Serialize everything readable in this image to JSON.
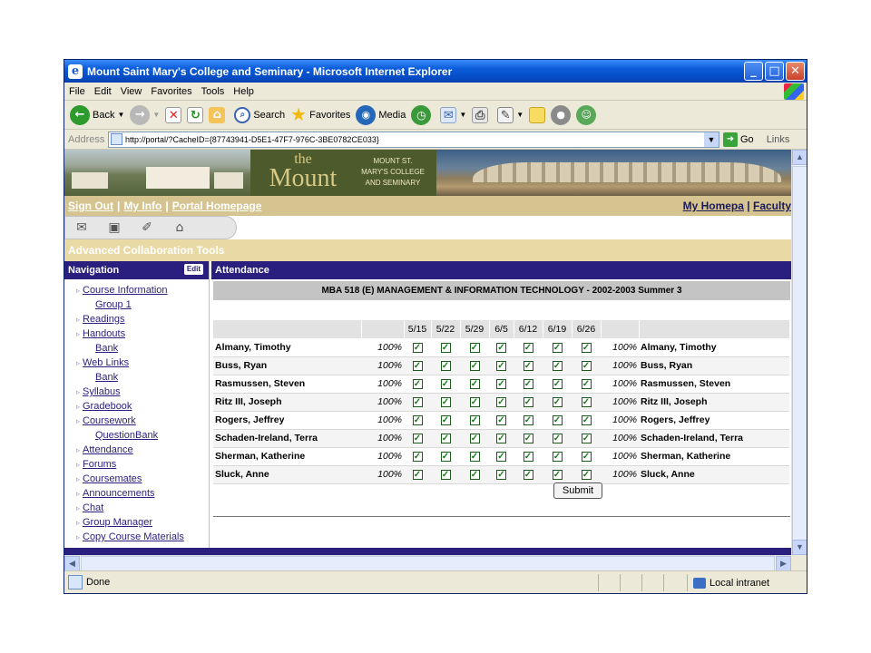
{
  "window": {
    "title": "Mount Saint Mary's College and Seminary - Microsoft Internet Explorer",
    "minimize_glyph": "_",
    "maximize_glyph": "□",
    "close_glyph": "✕"
  },
  "menu": [
    "File",
    "Edit",
    "View",
    "Favorites",
    "Tools",
    "Help"
  ],
  "toolbar": {
    "back_label": "Back",
    "search_label": "Search",
    "favorites_label": "Favorites",
    "media_label": "Media"
  },
  "address": {
    "label": "Address",
    "url": "http://portal/?CacheID={87743941-D5E1-47F7-976C-3BE0782CE033}",
    "go_label": "Go",
    "links_label": "Links"
  },
  "banner": {
    "logo_the": "the",
    "logo_mount": "Mount",
    "subtitle_line1": "MOUNT ST.",
    "subtitle_line2": "MARY'S COLLEGE",
    "subtitle_line3": "AND SEMINARY"
  },
  "portal_links": {
    "sign_out": "Sign Out",
    "my_info": "My Info",
    "portal_homepage": "Portal Homepage",
    "separator": "|",
    "my_homepage": "My Homepa",
    "faculty": "Faculty"
  },
  "section_title": "Advanced Collaboration Tools",
  "navigation": {
    "title": "Navigation",
    "edit_label": "Edit",
    "items": [
      {
        "label": "Course Information",
        "sub": false
      },
      {
        "label": "Group 1",
        "sub": true
      },
      {
        "label": "Readings",
        "sub": false
      },
      {
        "label": "Handouts",
        "sub": false
      },
      {
        "label": "Bank",
        "sub": true
      },
      {
        "label": "Web Links",
        "sub": false
      },
      {
        "label": "Bank",
        "sub": true
      },
      {
        "label": "Syllabus",
        "sub": false
      },
      {
        "label": "Gradebook",
        "sub": false
      },
      {
        "label": "Coursework",
        "sub": false
      },
      {
        "label": "QuestionBank",
        "sub": true
      },
      {
        "label": "Attendance",
        "sub": false
      },
      {
        "label": "Forums",
        "sub": false
      },
      {
        "label": "Coursemates",
        "sub": false
      },
      {
        "label": "Announcements",
        "sub": false
      },
      {
        "label": "Chat",
        "sub": false
      },
      {
        "label": "Group Manager",
        "sub": false
      },
      {
        "label": "Copy Course Materials",
        "sub": false
      }
    ]
  },
  "attendance": {
    "title": "Attendance",
    "course": "MBA 518 (E) MANAGEMENT & INFORMATION TECHNOLOGY - 2002-2003 Summer 3",
    "dates": [
      "5/15",
      "5/22",
      "5/29",
      "6/5",
      "6/12",
      "6/19",
      "6/26"
    ],
    "students": [
      {
        "name": "Almany, Timothy",
        "percent": "100%"
      },
      {
        "name": "Buss, Ryan",
        "percent": "100%"
      },
      {
        "name": "Rasmussen, Steven",
        "percent": "100%"
      },
      {
        "name": "Ritz III, Joseph",
        "percent": "100%"
      },
      {
        "name": "Rogers, Jeffrey",
        "percent": "100%"
      },
      {
        "name": "Schaden-Ireland, Terra",
        "percent": "100%"
      },
      {
        "name": "Sherman, Katherine",
        "percent": "100%"
      },
      {
        "name": "Sluck, Anne",
        "percent": "100%"
      }
    ],
    "check_glyph": "✓",
    "submit_label": "Submit"
  },
  "status": {
    "text": "Done",
    "zone": "Local intranet"
  }
}
